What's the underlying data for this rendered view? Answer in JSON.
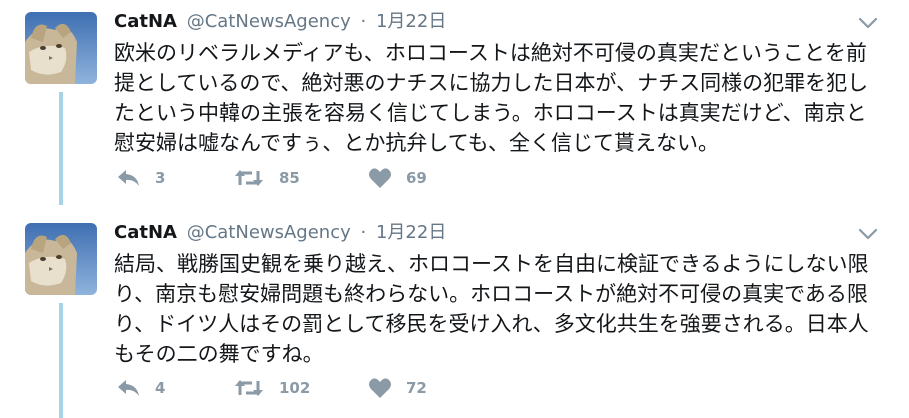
{
  "tweets": [
    {
      "name": "CatNA",
      "handle": "@CatNewsAgency",
      "separator": "·",
      "date": "1月22日",
      "text": "欧米のリベラルメディアも、ホロコーストは絶対不可侵の真実だということを前提としているので、絶対悪のナチスに協力した日本が、ナチス同様の犯罪を犯したという中韓の主張を容易く信じてしまう。ホロコーストは真実だけど、南京と慰安婦は嘘なんですぅ、とか抗弁しても、全く信じて貰えない。",
      "replies": "3",
      "retweets": "85",
      "likes": "69"
    },
    {
      "name": "CatNA",
      "handle": "@CatNewsAgency",
      "separator": "·",
      "date": "1月22日",
      "text": "結局、戦勝国史観を乗り越え、ホロコーストを自由に検証できるようにしない限り、南京も慰安婦問題も終わらない。ホロコーストが絶対不可侵の真実である限り、ドイツ人はその罰として移民を受け入れ、多文化共生を強要される。日本人もその二の舞ですね。",
      "replies": "4",
      "retweets": "102",
      "likes": "72"
    }
  ],
  "colors": {
    "text": "#14171a",
    "meta": "#657786",
    "icon": "#8a9aa6",
    "thread_line": "#a7d3e6"
  },
  "icons": [
    "cat-avatar",
    "chevron-down-icon",
    "reply-icon",
    "retweet-icon",
    "heart-icon"
  ]
}
